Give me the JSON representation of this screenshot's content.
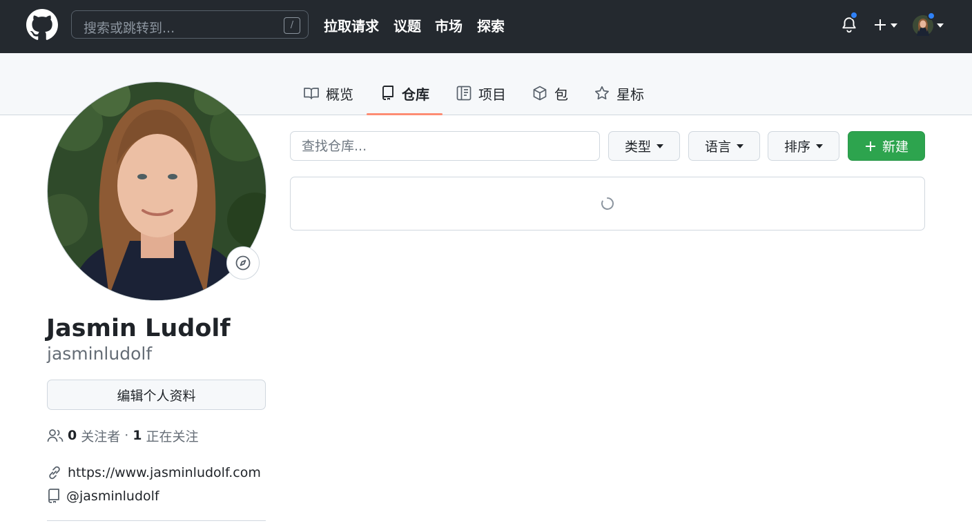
{
  "header": {
    "search_placeholder": "搜索或跳转到...",
    "search_shortcut": "/",
    "nav": [
      "拉取请求",
      "议题",
      "市场",
      "探索"
    ],
    "icons": [
      "github-logo",
      "bell-icon",
      "plus-icon",
      "caret-down-icon",
      "avatar"
    ]
  },
  "tabs": [
    {
      "label": "概览",
      "icon": "book-icon"
    },
    {
      "label": "仓库",
      "icon": "repo-icon",
      "selected": true
    },
    {
      "label": "项目",
      "icon": "project-icon"
    },
    {
      "label": "包",
      "icon": "package-icon"
    },
    {
      "label": "星标",
      "icon": "star-icon"
    }
  ],
  "profile": {
    "name": "Jasmin Ludolf",
    "username": "jasminludolf",
    "edit_button": "编辑个人资料",
    "followers_count": "0",
    "followers_label": "关注者",
    "separator": "·",
    "following_count": "1",
    "following_label": "正在关注",
    "website": "https://www.jasminludolf.com",
    "social": "@jasminludolf"
  },
  "repos": {
    "find_placeholder": "查找仓库...",
    "filters": [
      "类型",
      "语言",
      "排序"
    ],
    "new_button": "新建",
    "loading": true
  },
  "colors": {
    "header_bg": "#24292f",
    "accent_green": "#2da44e",
    "tab_underline": "#fd8c73",
    "notification_dot": "#2f81f7"
  }
}
